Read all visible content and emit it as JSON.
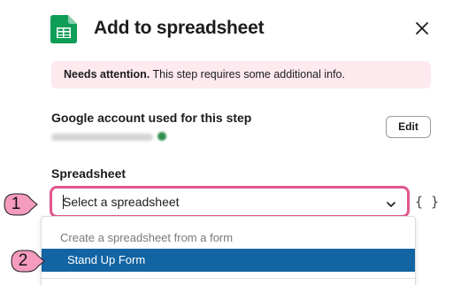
{
  "header": {
    "title": "Add to spreadsheet",
    "app_icon": "google-sheets-icon",
    "close_icon": "close-icon"
  },
  "alert": {
    "strong": "Needs attention.",
    "text": " This step requires some additional info."
  },
  "account": {
    "label": "Google account used for this step",
    "edit_label": "Edit"
  },
  "spreadsheet": {
    "label": "Spreadsheet",
    "placeholder": "Select a spreadsheet",
    "variable_icon": "{ }"
  },
  "dropdown": {
    "header": "Create a spreadsheet from a form",
    "options": [
      {
        "label": "Stand Up Form",
        "selected": true
      }
    ]
  },
  "callouts": [
    "1",
    "2"
  ],
  "colors": {
    "accent": "#1264a3",
    "focus_border": "#e2568e",
    "alert_bg": "#fde9ee",
    "callout": "#f59bbd",
    "sheets_green": "#0f9d58"
  }
}
